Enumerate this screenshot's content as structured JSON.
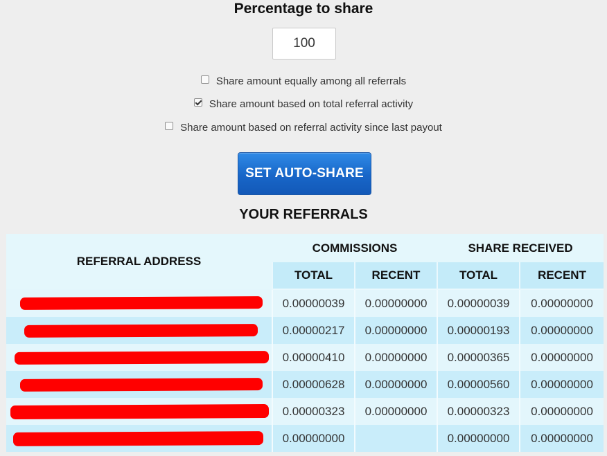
{
  "percentage_section": {
    "title": "Percentage to share",
    "value": "100"
  },
  "share_options": [
    {
      "label": "Share amount equally among all referrals",
      "checked": false
    },
    {
      "label": "Share amount based on total referral activity",
      "checked": true
    },
    {
      "label": "Share amount based on referral activity since last payout",
      "checked": false
    }
  ],
  "set_button": {
    "label": "SET AUTO-SHARE"
  },
  "referrals": {
    "title": "YOUR REFERRALS",
    "headers": {
      "address": "REFERRAL ADDRESS",
      "commissions": "COMMISSIONS",
      "share_received": "SHARE RECEIVED",
      "total": "TOTAL",
      "recent": "RECENT"
    },
    "rows": [
      {
        "comm_total": "0.00000039",
        "comm_recent": "0.00000000",
        "share_total": "0.00000039",
        "share_recent": "0.00000000"
      },
      {
        "comm_total": "0.00000217",
        "comm_recent": "0.00000000",
        "share_total": "0.00000193",
        "share_recent": "0.00000000"
      },
      {
        "comm_total": "0.00000410",
        "comm_recent": "0.00000000",
        "share_total": "0.00000365",
        "share_recent": "0.00000000"
      },
      {
        "comm_total": "0.00000628",
        "comm_recent": "0.00000000",
        "share_total": "0.00000560",
        "share_recent": "0.00000000"
      },
      {
        "comm_total": "0.00000323",
        "comm_recent": "0.00000000",
        "share_total": "0.00000323",
        "share_recent": "0.00000000"
      },
      {
        "comm_total": "0.00000000",
        "comm_recent": "",
        "share_total": "0.00000000",
        "share_recent": "0.00000000"
      }
    ]
  },
  "colors": {
    "page_bg": "#eeeeee",
    "button": "#1866c8",
    "table_light": "#e3f6fc",
    "table_dark": "#c9edfa",
    "redaction": "#ff0000"
  }
}
